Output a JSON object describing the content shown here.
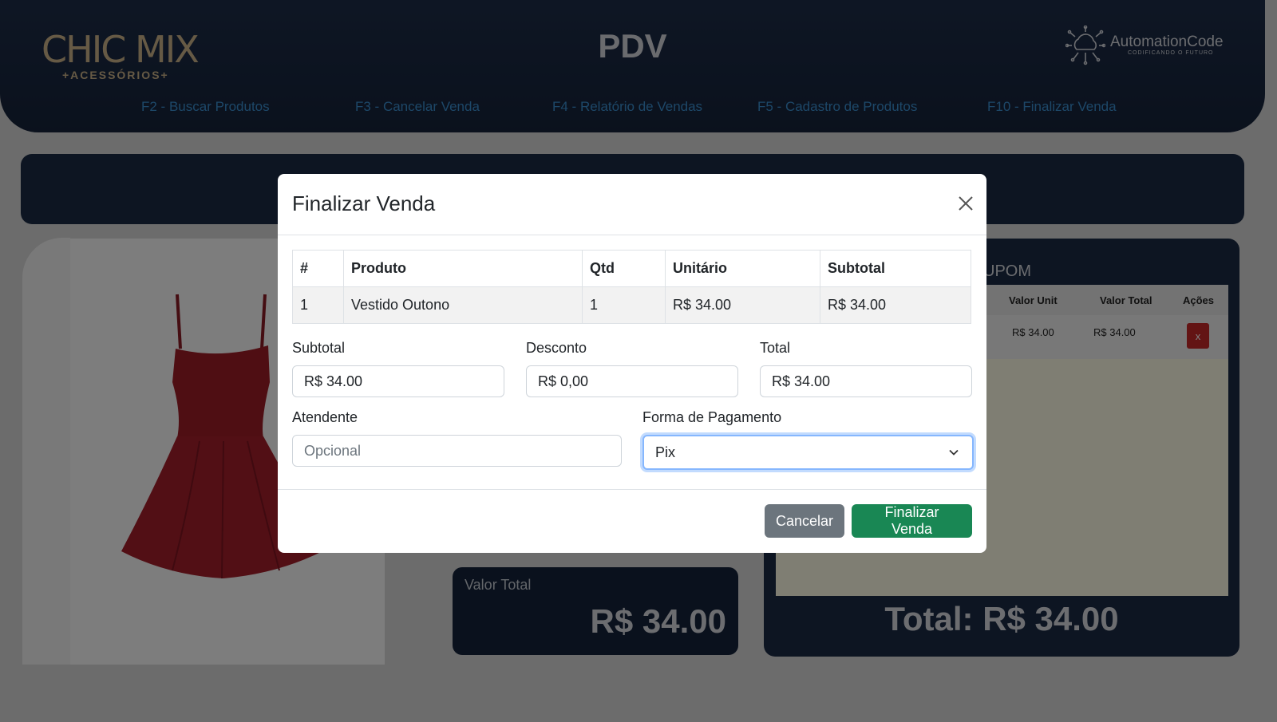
{
  "header": {
    "logo_main": "CHIC MIX",
    "logo_sub": "+ACESSÓRIOS+",
    "title": "PDV",
    "brand_name": "AutomationCode",
    "brand_tagline": "CODIFICANDO O FUTURO",
    "nav": [
      {
        "label": "F2 - Buscar Produtos"
      },
      {
        "label": "F3 - Cancelar Venda"
      },
      {
        "label": "F4 - Relatório de Vendas"
      },
      {
        "label": "F5 - Cadastro de Produtos"
      },
      {
        "label": "F10 - Finalizar Venda"
      }
    ]
  },
  "cart": {
    "title_fragment": "UPOM",
    "columns": [
      "Valor Unit",
      "Valor Total",
      "Ações"
    ],
    "row": {
      "unit": "R$ 34.00",
      "total": "R$ 34.00",
      "delete_label": "x"
    },
    "total_text": "Total: R$ 34.00"
  },
  "value_box": {
    "label": "Valor Total",
    "value": "R$ 34.00"
  },
  "modal": {
    "title": "Finalizar Venda",
    "table": {
      "columns": [
        "#",
        "Produto",
        "Qtd",
        "Unitário",
        "Subtotal"
      ],
      "rows": [
        {
          "num": "1",
          "produto": "Vestido Outono",
          "qtd": "1",
          "unitario": "R$ 34.00",
          "subtotal": "R$ 34.00"
        }
      ]
    },
    "subtotal": {
      "label": "Subtotal",
      "value": "R$ 34.00"
    },
    "desconto": {
      "label": "Desconto",
      "value": "R$ 0,00"
    },
    "total": {
      "label": "Total",
      "value": "R$ 34.00"
    },
    "atendente": {
      "label": "Atendente",
      "placeholder": "Opcional"
    },
    "pagamento": {
      "label": "Forma de Pagamento",
      "selected": "Pix"
    },
    "cancel_label": "Cancelar",
    "finalize_label": "Finalizar Venda"
  },
  "colors": {
    "header_bg": "#1b2a44",
    "nav_link": "#3a8fd1",
    "logo_gold": "#cdb48a",
    "primary_green": "#198754",
    "secondary_gray": "#6c757d",
    "danger_red": "#c62828"
  },
  "icons": [
    "close-icon",
    "chevron-down-icon",
    "brand-circuit-icon"
  ]
}
